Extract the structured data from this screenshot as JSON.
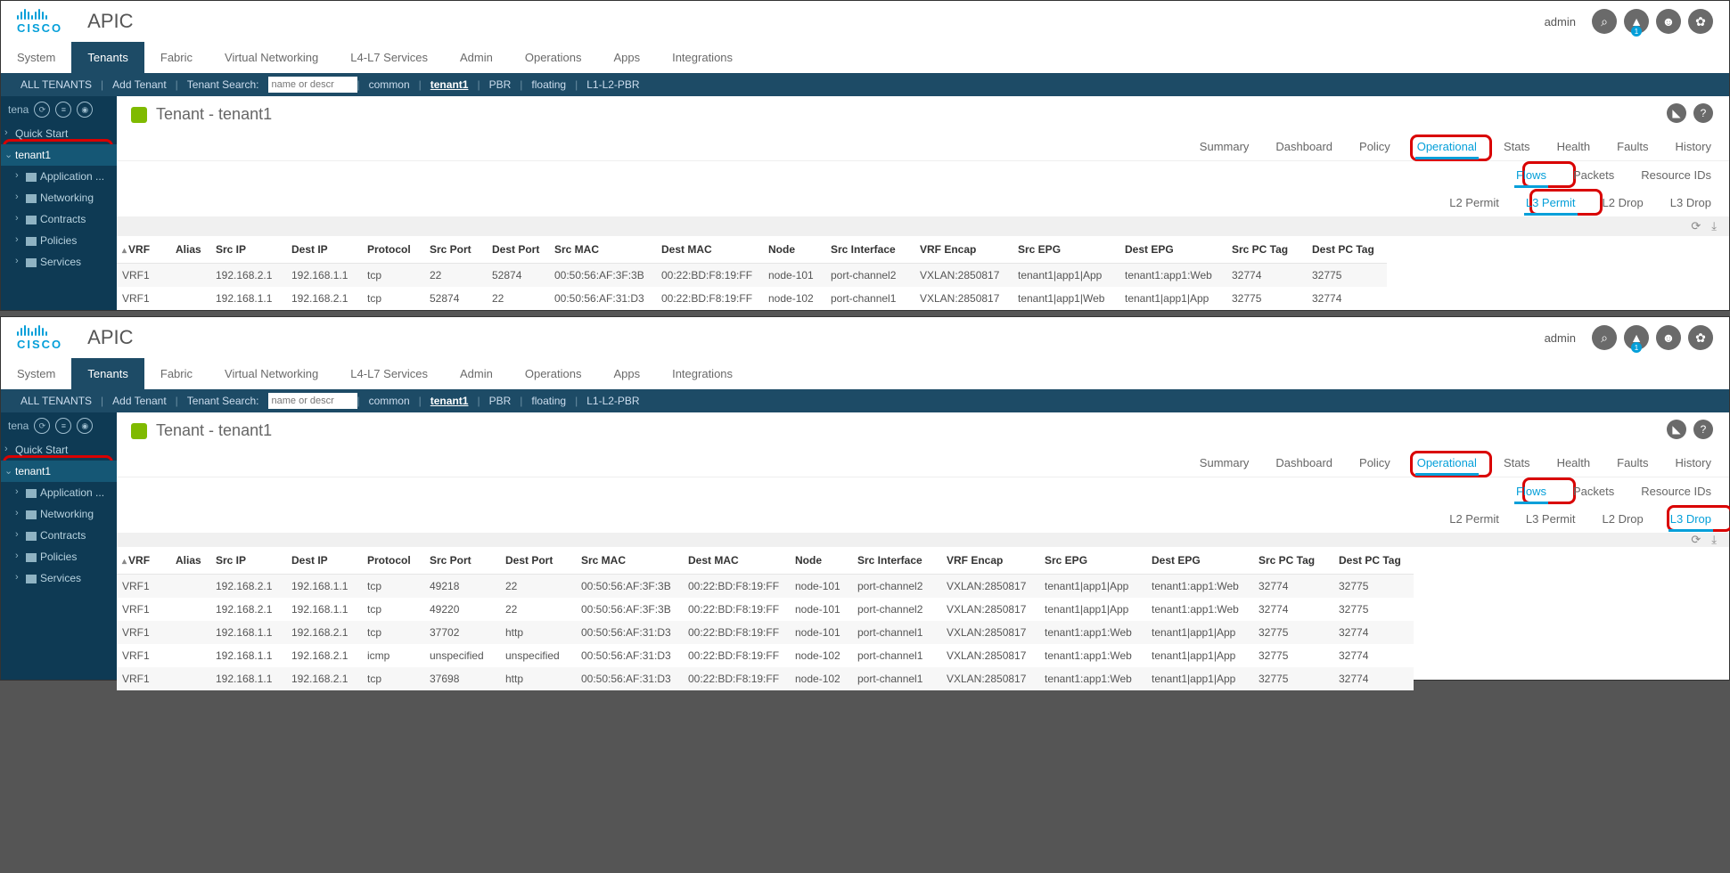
{
  "brand": "CISCO",
  "app_title": "APIC",
  "user": "admin",
  "bell_badge": "1",
  "main_nav": [
    "System",
    "Tenants",
    "Fabric",
    "Virtual Networking",
    "L4-L7 Services",
    "Admin",
    "Operations",
    "Apps",
    "Integrations"
  ],
  "main_nav_active": "Tenants",
  "sub_nav": {
    "all": "ALL TENANTS",
    "add": "Add Tenant",
    "search_label": "Tenant Search:",
    "search_placeholder": "name or descr",
    "items": [
      "common",
      "tenant1",
      "PBR",
      "floating",
      "L1-L2-PBR"
    ]
  },
  "sidebar": {
    "title": "tena",
    "items": [
      "Quick Start",
      "tenant1",
      "Application ...",
      "Networking",
      "Contracts",
      "Policies",
      "Services"
    ]
  },
  "crumb": "Tenant - tenant1",
  "tabs": [
    "Summary",
    "Dashboard",
    "Policy",
    "Operational",
    "Stats",
    "Health",
    "Faults",
    "History"
  ],
  "tabs_active": "Operational",
  "subtabs": [
    "Flows",
    "Packets",
    "Resource IDs"
  ],
  "subtabs_active": "Flows",
  "headers": [
    "VRF",
    "Alias",
    "Src IP",
    "Dest IP",
    "Protocol",
    "Src Port",
    "Dest Port",
    "Src MAC",
    "Dest MAC",
    "Node",
    "Src Interface",
    "VRF Encap",
    "Src EPG",
    "Dest EPG",
    "Src PC Tag",
    "Dest PC Tag"
  ],
  "panel1": {
    "subsub": [
      "L2 Permit",
      "L3 Permit",
      "L2 Drop",
      "L3 Drop"
    ],
    "subsub_active": "L3 Permit",
    "rows": [
      [
        "VRF1",
        "",
        "192.168.2.1",
        "192.168.1.1",
        "tcp",
        "22",
        "52874",
        "00:50:56:AF:3F:3B",
        "00:22:BD:F8:19:FF",
        "node-101",
        "port-channel2",
        "VXLAN:2850817",
        "tenant1|app1|App",
        "tenant1:app1:Web",
        "32774",
        "32775"
      ],
      [
        "VRF1",
        "",
        "192.168.1.1",
        "192.168.2.1",
        "tcp",
        "52874",
        "22",
        "00:50:56:AF:31:D3",
        "00:22:BD:F8:19:FF",
        "node-102",
        "port-channel1",
        "VXLAN:2850817",
        "tenant1|app1|Web",
        "tenant1|app1|App",
        "32775",
        "32774"
      ]
    ]
  },
  "panel2": {
    "subsub": [
      "L2 Permit",
      "L3 Permit",
      "L2 Drop",
      "L3 Drop"
    ],
    "subsub_active": "L3 Drop",
    "rows": [
      [
        "VRF1",
        "",
        "192.168.2.1",
        "192.168.1.1",
        "tcp",
        "49218",
        "22",
        "00:50:56:AF:3F:3B",
        "00:22:BD:F8:19:FF",
        "node-101",
        "port-channel2",
        "VXLAN:2850817",
        "tenant1|app1|App",
        "tenant1:app1:Web",
        "32774",
        "32775"
      ],
      [
        "VRF1",
        "",
        "192.168.2.1",
        "192.168.1.1",
        "tcp",
        "49220",
        "22",
        "00:50:56:AF:3F:3B",
        "00:22:BD:F8:19:FF",
        "node-101",
        "port-channel2",
        "VXLAN:2850817",
        "tenant1|app1|App",
        "tenant1:app1:Web",
        "32774",
        "32775"
      ],
      [
        "VRF1",
        "",
        "192.168.1.1",
        "192.168.2.1",
        "tcp",
        "37702",
        "http",
        "00:50:56:AF:31:D3",
        "00:22:BD:F8:19:FF",
        "node-101",
        "port-channel1",
        "VXLAN:2850817",
        "tenant1:app1:Web",
        "tenant1|app1|App",
        "32775",
        "32774"
      ],
      [
        "VRF1",
        "",
        "192.168.1.1",
        "192.168.2.1",
        "icmp",
        "unspecified",
        "unspecified",
        "00:50:56:AF:31:D3",
        "00:22:BD:F8:19:FF",
        "node-102",
        "port-channel1",
        "VXLAN:2850817",
        "tenant1:app1:Web",
        "tenant1|app1|App",
        "32775",
        "32774"
      ],
      [
        "VRF1",
        "",
        "192.168.1.1",
        "192.168.2.1",
        "tcp",
        "37698",
        "http",
        "00:50:56:AF:31:D3",
        "00:22:BD:F8:19:FF",
        "node-102",
        "port-channel1",
        "VXLAN:2850817",
        "tenant1:app1:Web",
        "tenant1|app1|App",
        "32775",
        "32774"
      ]
    ]
  }
}
